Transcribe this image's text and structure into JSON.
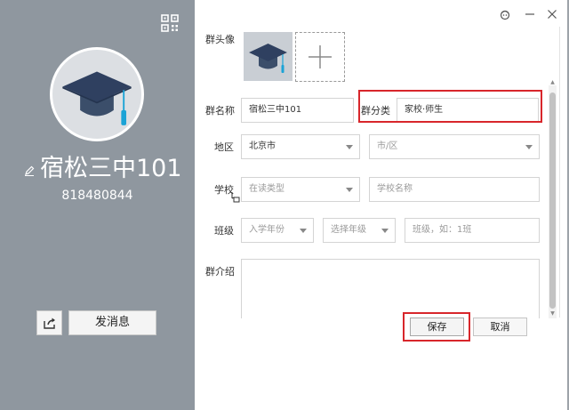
{
  "profile": {
    "group_name": "宿松三中101",
    "group_number": "818480844",
    "send_message_label": "发消息"
  },
  "form": {
    "avatar_label": "群头像",
    "name_label": "群名称",
    "name_value": "宿松三中101",
    "category_label": "群分类",
    "category_value": "家校·师生",
    "region_label": "地区",
    "city_value": "北京市",
    "district_placeholder": "市/区",
    "school_label": "学校",
    "school_type_placeholder": "在读类型",
    "school_name_placeholder": "学校名称",
    "class_label": "班级",
    "enroll_year_placeholder": "入学年份",
    "grade_placeholder": "选择年级",
    "class_placeholder": "班级，如：1班",
    "intro_label": "群介绍",
    "intro_value": ""
  },
  "buttons": {
    "save": "保存",
    "cancel": "取消"
  },
  "colors": {
    "left_panel": "#8f979f",
    "highlight": "#d8262b"
  },
  "icons": [
    "qr-code-icon",
    "edit-icon",
    "graduation-cap-icon",
    "share-icon",
    "plus-icon",
    "face-icon",
    "minimize-icon",
    "close-icon"
  ]
}
